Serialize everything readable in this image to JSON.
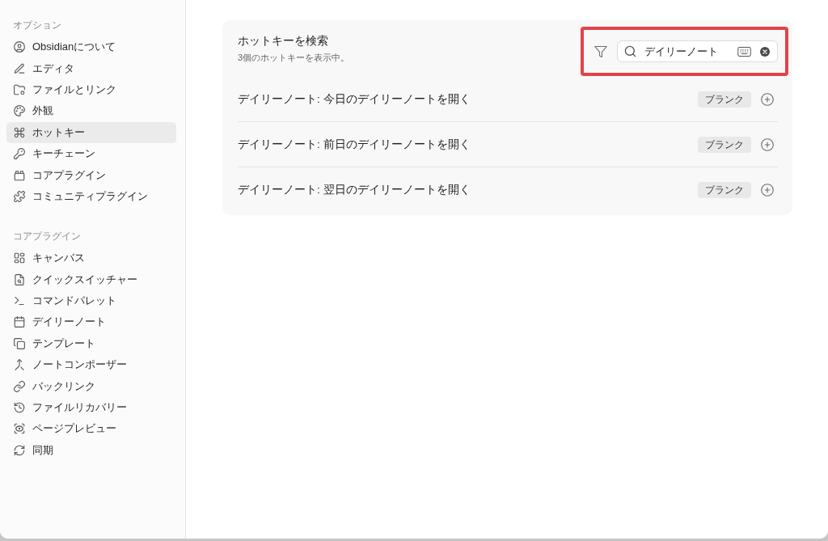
{
  "sidebar": {
    "sections": [
      {
        "heading": "オプション",
        "items": [
          {
            "label": "Obsidianについて",
            "selected": false
          },
          {
            "label": "エディタ",
            "selected": false
          },
          {
            "label": "ファイルとリンク",
            "selected": false
          },
          {
            "label": "外観",
            "selected": false
          },
          {
            "label": "ホットキー",
            "selected": true
          },
          {
            "label": "キーチェーン",
            "selected": false
          },
          {
            "label": "コアプラグイン",
            "selected": false
          },
          {
            "label": "コミュニティプラグイン",
            "selected": false
          }
        ]
      },
      {
        "heading": "コアプラグイン",
        "items": [
          {
            "label": "キャンバス",
            "selected": false
          },
          {
            "label": "クイックスイッチャー",
            "selected": false
          },
          {
            "label": "コマンドパレット",
            "selected": false
          },
          {
            "label": "デイリーノート",
            "selected": false
          },
          {
            "label": "テンプレート",
            "selected": false
          },
          {
            "label": "ノートコンポーザー",
            "selected": false
          },
          {
            "label": "バックリンク",
            "selected": false
          },
          {
            "label": "ファイルリカバリー",
            "selected": false
          },
          {
            "label": "ページプレビュー",
            "selected": false
          },
          {
            "label": "同期",
            "selected": false
          }
        ]
      }
    ]
  },
  "hotkeys": {
    "title": "ホットキーを検索",
    "subtitle": "3個のホットキーを表示中。",
    "search": {
      "value": "デイリーノート",
      "highlighted": true
    },
    "rows": [
      {
        "command": "デイリーノート: 今日のデイリーノートを開く",
        "hotkey": "ブランク"
      },
      {
        "command": "デイリーノート: 前日のデイリーノートを開く",
        "hotkey": "ブランク"
      },
      {
        "command": "デイリーノート: 翌日のデイリーノートを開く",
        "hotkey": "ブランク"
      }
    ]
  }
}
